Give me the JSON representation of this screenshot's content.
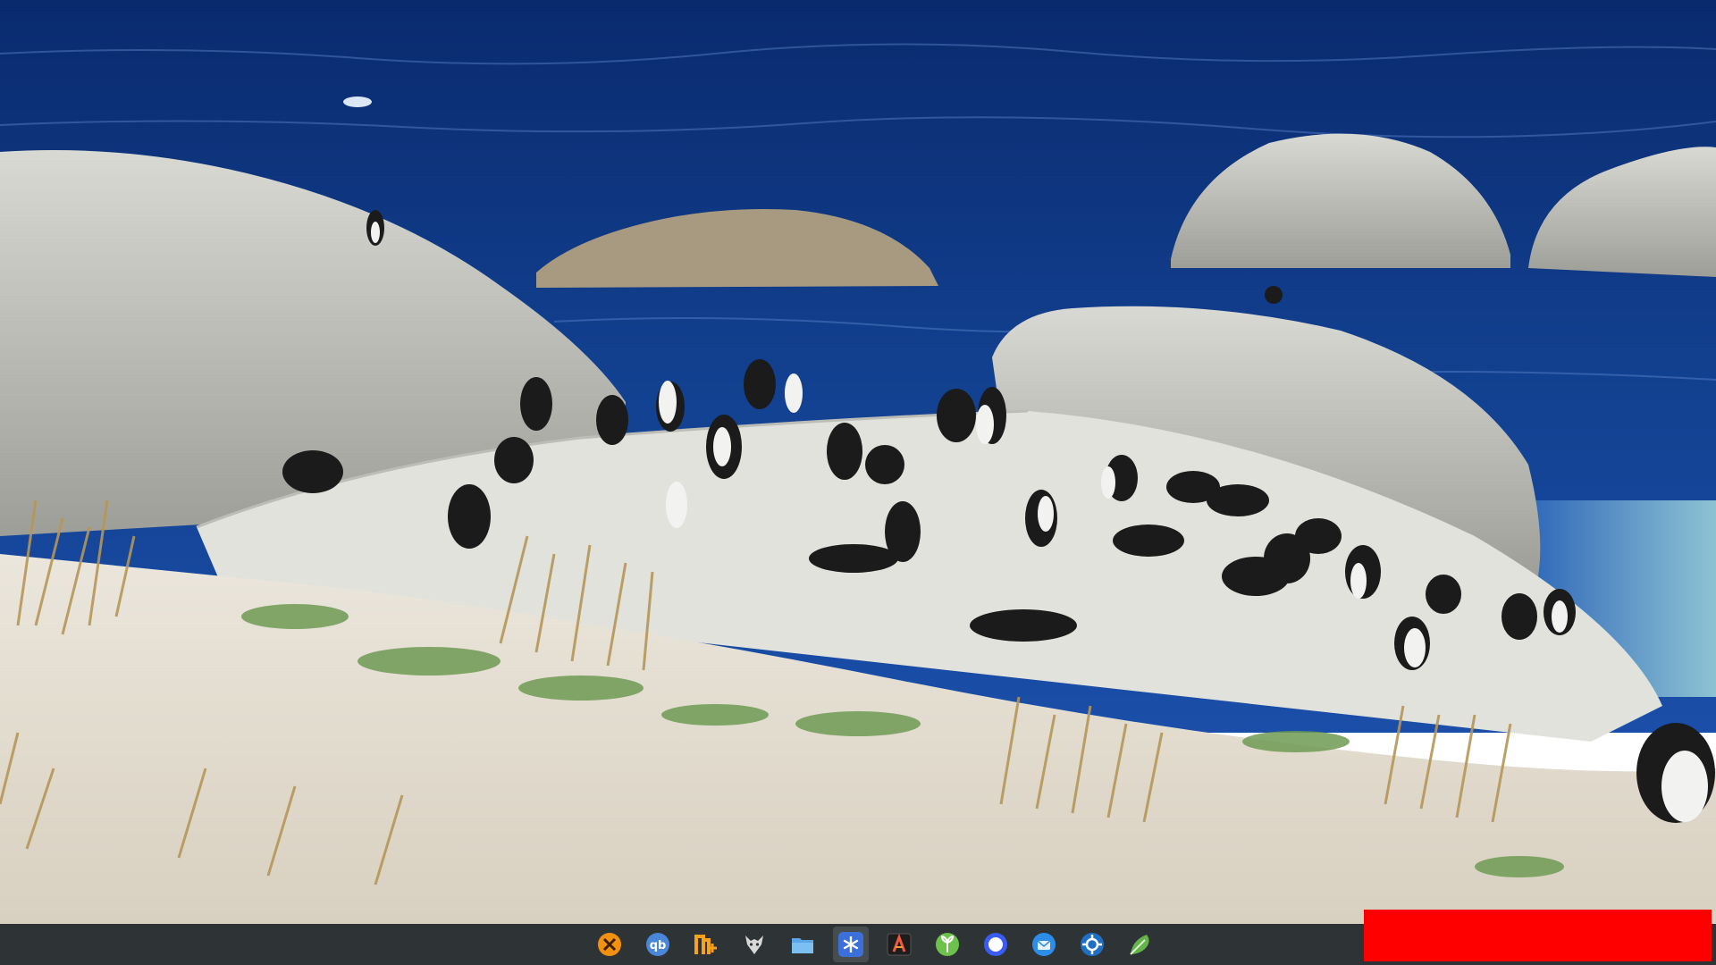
{
  "wallpaper": {
    "name": "penguin-beach-wallpaper",
    "colors": {
      "sea_deep": "#0a2f7a",
      "sea_mid": "#1a4ea8",
      "sea_shallow": "#7fb7c9",
      "rock": "#cfcfca",
      "rock_shadow": "#8d8d88",
      "sand": "#e9e4da",
      "grass": "#b99a5c",
      "shrub": "#6f9a54"
    }
  },
  "taskbar": {
    "background": "#2e3436",
    "apps": [
      {
        "id": "xcross",
        "icon": "x-cross-app-icon",
        "color": "#f29111"
      },
      {
        "id": "qbittorrent",
        "icon": "qbittorrent-icon",
        "color": "#4a87d8",
        "text": "qb"
      },
      {
        "id": "app-n",
        "icon": "n-plus-app-icon",
        "color": "#f7a21a"
      },
      {
        "id": "gnome-wolf",
        "icon": "wolf-head-icon",
        "color": "#d8d8d8"
      },
      {
        "id": "files",
        "icon": "folder-icon",
        "color": "#5aa6e6"
      },
      {
        "id": "snowflake",
        "icon": "snowflake-icon",
        "color": "#3b6fd9",
        "active": true
      },
      {
        "id": "terminal-a",
        "icon": "terminal-a-icon",
        "color": "#1d1d1d"
      },
      {
        "id": "green-app",
        "icon": "green-leaf-app-icon",
        "color": "#6cc24a"
      },
      {
        "id": "blue-circle",
        "icon": "blue-circle-icon",
        "color": "#3a5bf5"
      },
      {
        "id": "thunderbird",
        "icon": "mail-bird-icon",
        "color": "#2c8ee8"
      },
      {
        "id": "settings-blue",
        "icon": "blue-gear-app-icon",
        "color": "#1f6fc4"
      },
      {
        "id": "gedit-leaf",
        "icon": "text-editor-leaf-icon",
        "color": "#64b44b"
      }
    ]
  },
  "overlay": {
    "red_block_color": "#ff0000"
  }
}
